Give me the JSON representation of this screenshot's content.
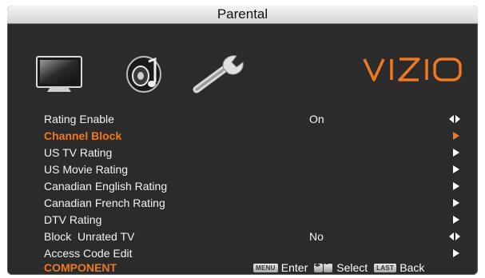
{
  "window": {
    "title": "Parental"
  },
  "brand": {
    "logo_text": "VIZIO"
  },
  "icons": [
    "tv-icon",
    "speaker-icon",
    "wrench-tools-icon"
  ],
  "menu": {
    "items": [
      {
        "label": "Rating Enable",
        "value": "On",
        "control": "left-right-arrows"
      },
      {
        "label": "Channel Block",
        "value": "",
        "control": "right-arrow",
        "selected": true
      },
      {
        "label": "US TV Rating",
        "value": "",
        "control": "right-arrow"
      },
      {
        "label": "US Movie Rating",
        "value": "",
        "control": "right-arrow"
      },
      {
        "label": "Canadian English Rating",
        "value": "",
        "control": "right-arrow"
      },
      {
        "label": "Canadian French Rating",
        "value": "",
        "control": "right-arrow"
      },
      {
        "label": "DTV Rating",
        "value": "",
        "control": "right-arrow"
      },
      {
        "label": "Block  Unrated TV",
        "value": "No",
        "control": "left-right-arrows"
      },
      {
        "label": "Access Code Edit",
        "value": "",
        "control": "right-arrow"
      }
    ]
  },
  "footer": {
    "source": "COMPONENT",
    "menu_key": "MENU",
    "enter_label": "Enter",
    "select_label": "Select",
    "last_key": "LAST",
    "back_label": "Back"
  },
  "colors": {
    "background": "#2b2b2b",
    "accent": "#f07820",
    "text": "#f2f2f2",
    "titlebar": "#e6e6e6"
  }
}
